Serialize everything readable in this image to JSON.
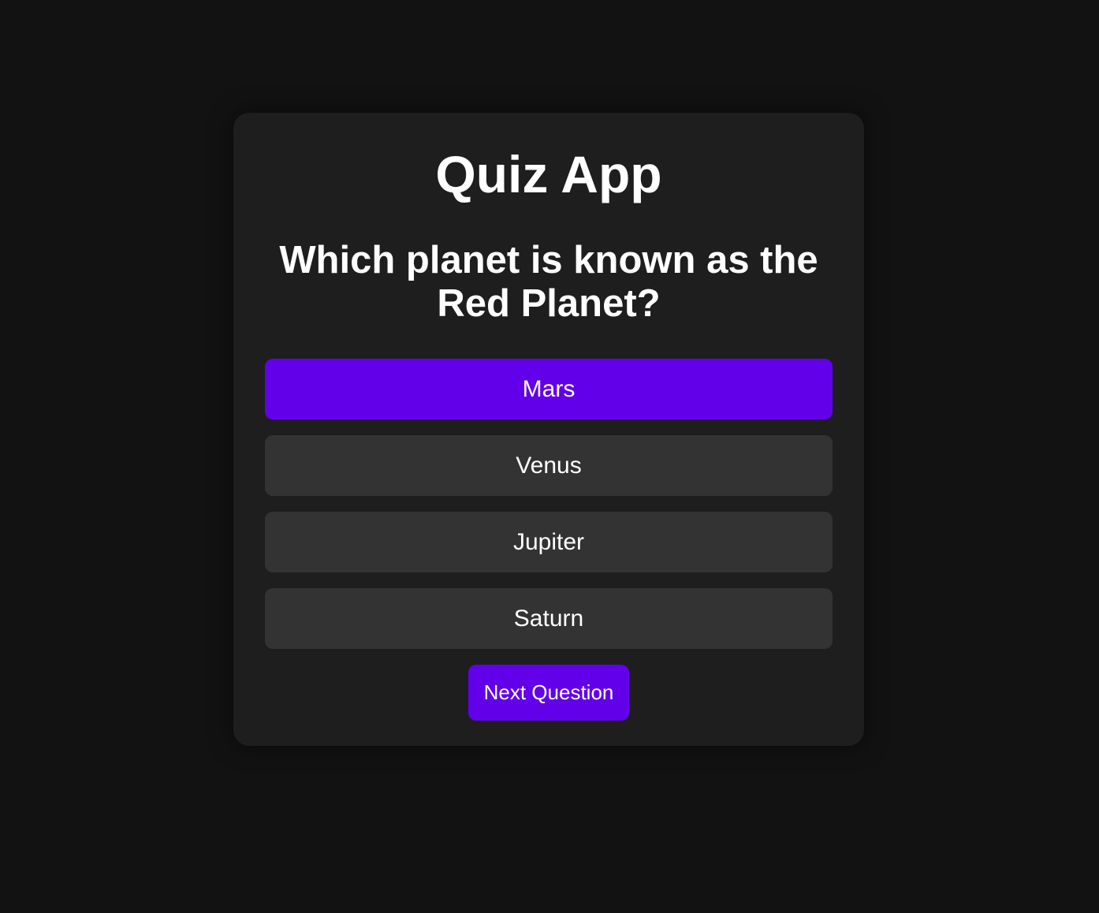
{
  "app": {
    "title": "Quiz App"
  },
  "question": {
    "text": "Which planet is known as the Red Planet?",
    "answers": [
      {
        "label": "Mars",
        "selected": true
      },
      {
        "label": "Venus",
        "selected": false
      },
      {
        "label": "Jupiter",
        "selected": false
      },
      {
        "label": "Saturn",
        "selected": false
      }
    ]
  },
  "next_label": "Next Question",
  "colors": {
    "accent": "#6200ea",
    "option": "#333333",
    "card": "#1e1e1e",
    "background": "#121212"
  }
}
